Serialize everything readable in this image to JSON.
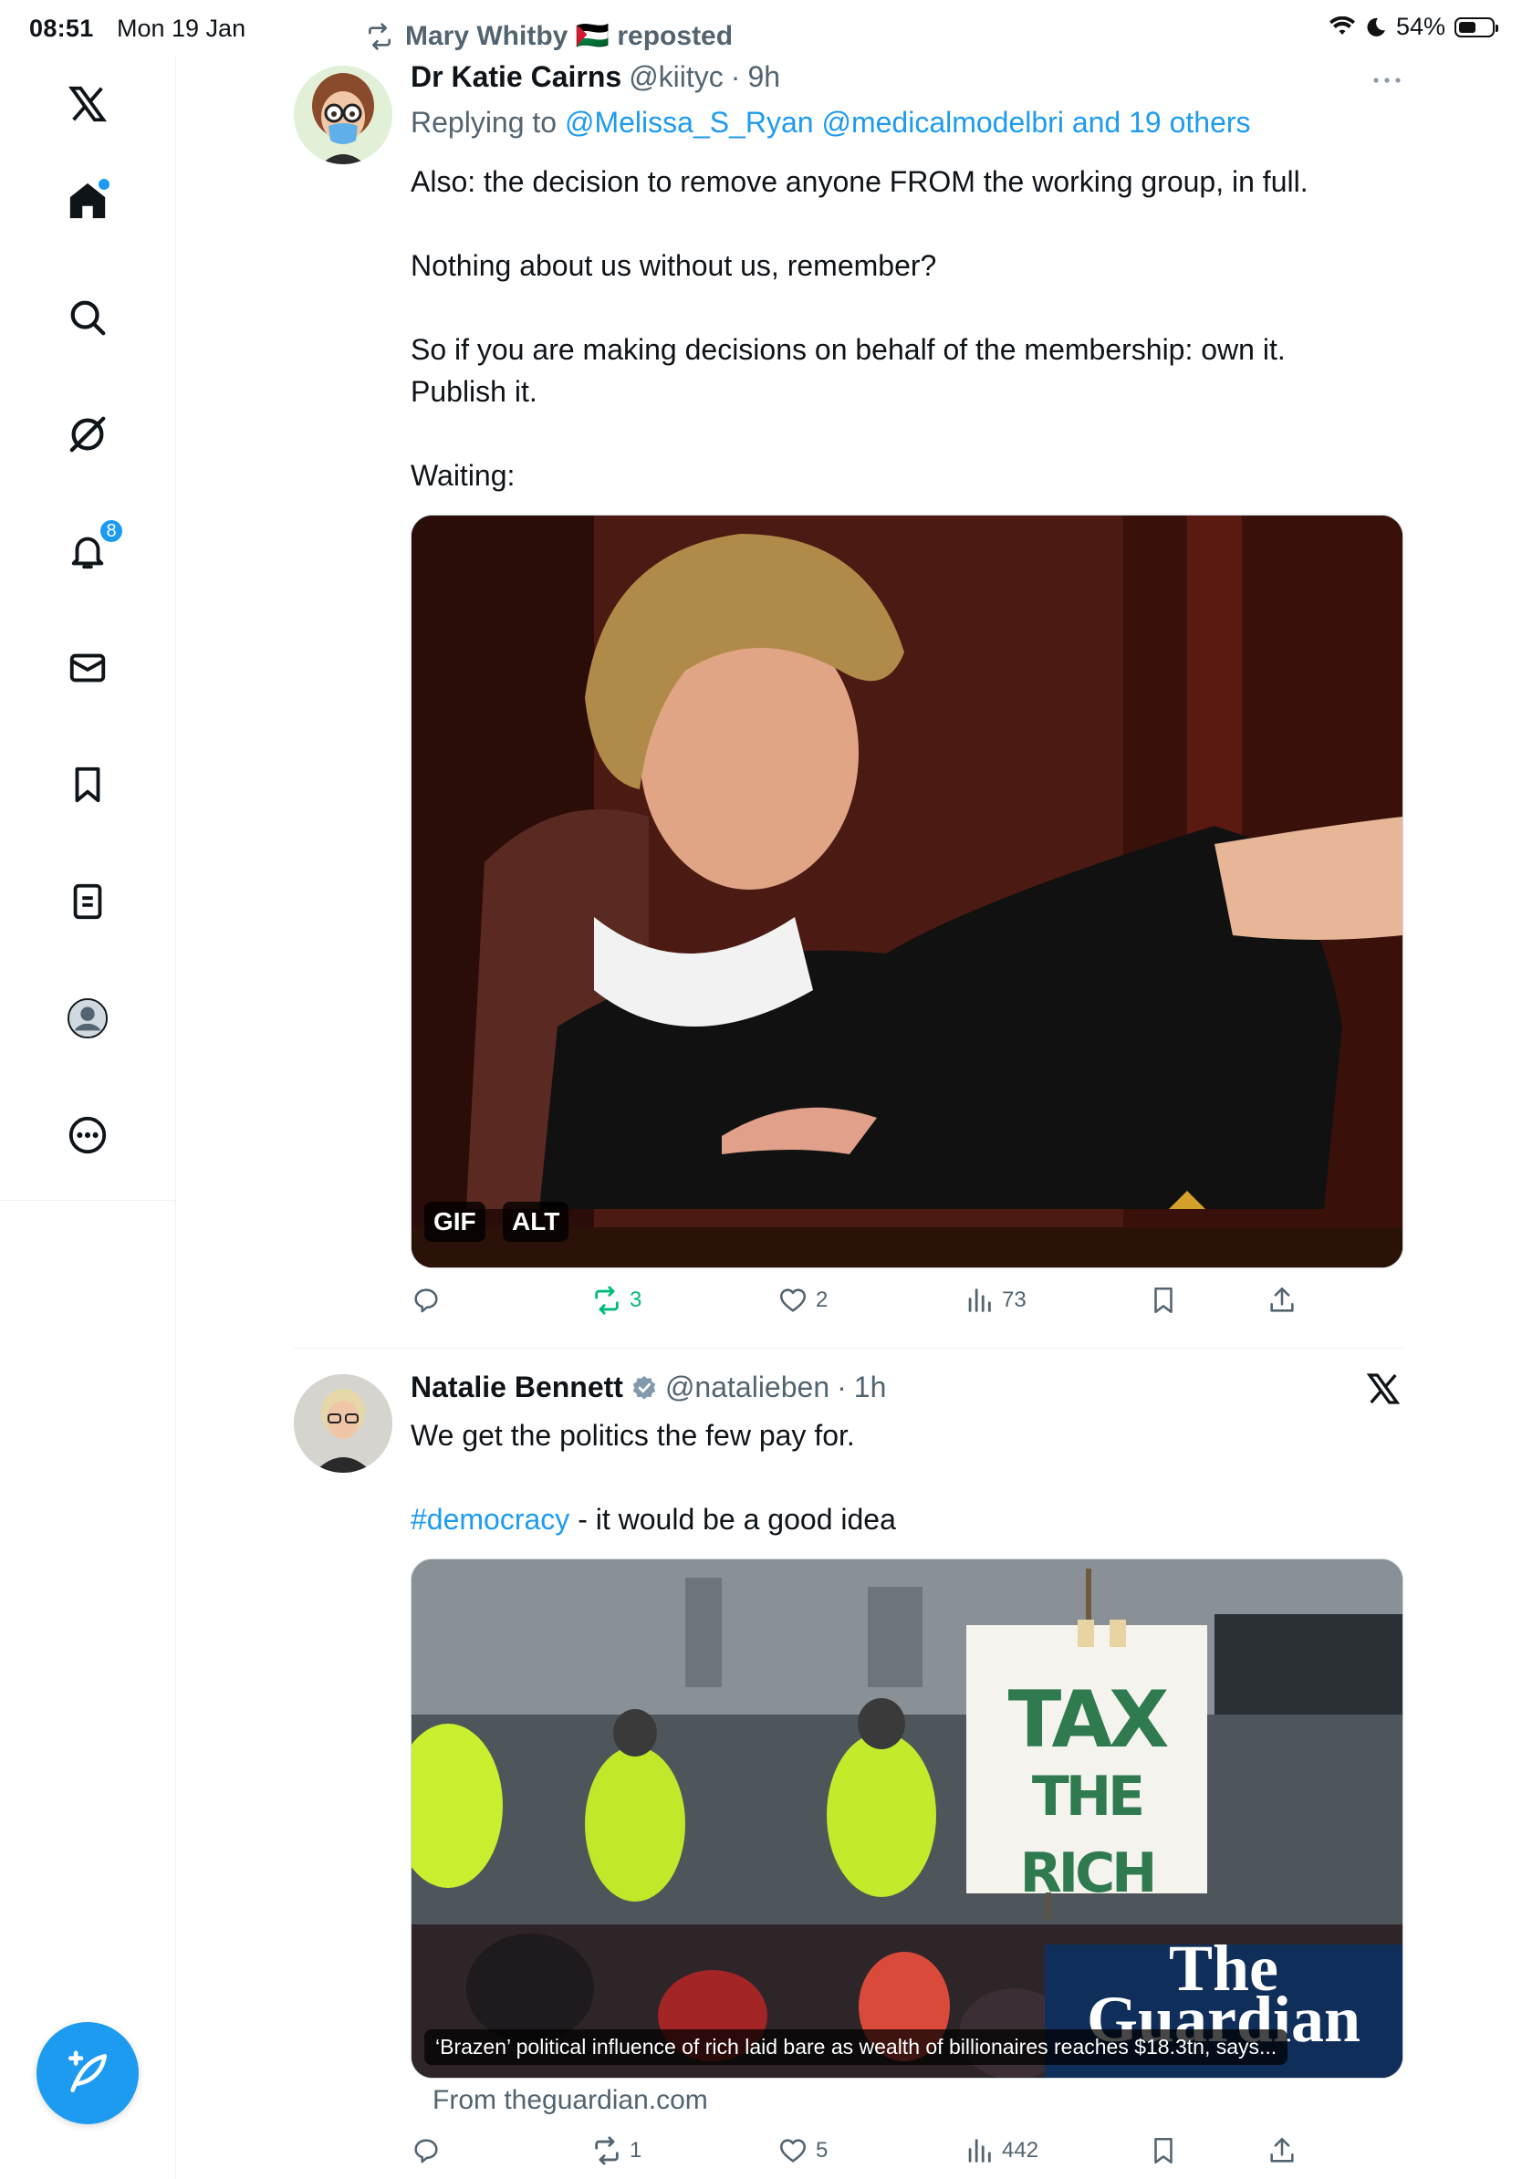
{
  "status_bar": {
    "time": "08:51",
    "date": "Mon 19 Jan",
    "battery": "54%",
    "battery_level": 0.54
  },
  "sidebar": {
    "notifications_badge": "8",
    "icons": [
      "x-logo-icon",
      "home-icon",
      "search-icon",
      "grok-icon",
      "bell-icon",
      "mail-icon",
      "bookmark-icon",
      "lists-icon",
      "profile-icon",
      "more-icon"
    ]
  },
  "tweet1": {
    "repost_label": "Mary Whitby 🇵🇸 reposted",
    "name": "Dr Katie Cairns",
    "handle": "@kiityc",
    "time": "9h",
    "replying_prefix": "Replying to",
    "replying_to": "@Melissa_S_Ryan @medicalmodelbri and 19 others",
    "paragraphs": [
      "Also: the decision to remove anyone FROM the working group, in full.",
      "Nothing about us without us, remember?",
      "So if you are making decisions on behalf of the membership: own it. Publish it.",
      "Waiting:"
    ],
    "media_badges": {
      "gif": "GIF",
      "alt": "ALT"
    },
    "stats": {
      "replies": "",
      "reposts": "3",
      "likes": "2",
      "views": "73"
    }
  },
  "tweet2": {
    "name": "Natalie Bennett",
    "handle": "@natalieben",
    "time": "1h",
    "line1": "We get the politics the few pay for.",
    "hashtag": "#democracy",
    "line2_rest": " - it would be a good idea",
    "sign_line1": "TAX",
    "sign_line2": "THE RICH",
    "guardian_line1": "The",
    "guardian_line2": "Guardian",
    "card_title": "‘Brazen’ political influence of rich laid bare as wealth of billionaires reaches $18.3tn, says...",
    "card_source": "From theguardian.com",
    "stats": {
      "replies": "",
      "reposts": "1",
      "likes": "5",
      "views": "442"
    }
  },
  "colors": {
    "accent": "#1d9bf0",
    "repost_green": "#00ba7c",
    "muted": "#536471"
  }
}
